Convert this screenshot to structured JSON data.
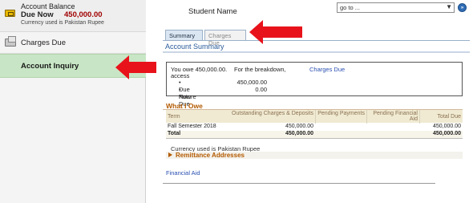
{
  "sidebar": {
    "account_balance": {
      "title": "Account Balance",
      "due_label": "Due Now",
      "due_amount": "450,000.00",
      "currency_note": "Currency used is Pakistan Rupee",
      "icon": "wallet-icon"
    },
    "items": [
      {
        "label": "Charges Due",
        "icon": "charges-icon"
      },
      {
        "label": "Account Inquiry",
        "selected": true
      }
    ]
  },
  "header": {
    "student_name": "Student Name",
    "goto_value": "go to ...",
    "goto_button_label": "»"
  },
  "tabs": [
    {
      "label": "Summary",
      "active": true
    },
    {
      "label": "Charges Due",
      "active": false
    }
  ],
  "account_summary": {
    "title": "Account Summary",
    "you_owe": "You owe 450,000.00.",
    "breakdown_text": "For the breakdown,",
    "breakdown_link": "Charges Due",
    "access_text": "access",
    "bullets": [
      {
        "label": "Due Now",
        "value": "450,000.00"
      },
      {
        "label": "Future Due",
        "value": "0.00"
      }
    ]
  },
  "what_i_owe": {
    "title": "What I Owe",
    "columns": [
      "Term",
      "Outstanding Charges & Deposits",
      "Pending Payments",
      "Pending Financial Aid",
      "Total Due"
    ],
    "rows": [
      {
        "term": "Fall Semester 2018",
        "outstanding": "450,000.00",
        "pending_payments": "",
        "pending_aid": "",
        "total": "450,000.00"
      },
      {
        "term": "Total",
        "outstanding": "450,000.00",
        "pending_payments": "",
        "pending_aid": "",
        "total": "450,000.00"
      }
    ],
    "currency_note": "Currency used is Pakistan Rupee"
  },
  "remittance": {
    "label": "Remittance Addresses"
  },
  "financial_aid_link": "Financial Aid",
  "colors": {
    "accent_red_arrow": "#e8121b",
    "selected_nav": "#c8e6c5",
    "section_title_blue": "#2a5b9a",
    "section_title_orange": "#b35a00",
    "amount_red": "#a00000"
  }
}
